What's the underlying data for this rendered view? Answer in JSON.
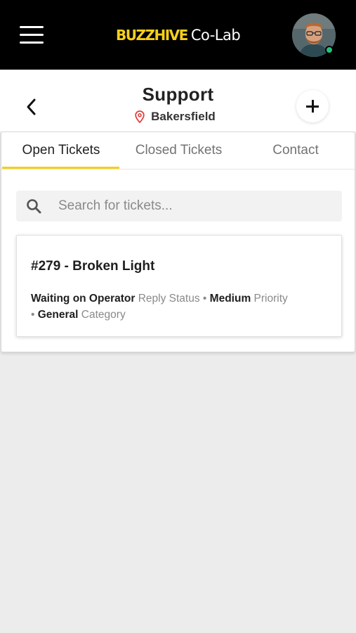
{
  "brand": {
    "buzz": "BUZZHIVE",
    "colab": "Co-Lab",
    "accent_color": "#f5cf1a"
  },
  "user": {
    "online_status_color": "#22c27d"
  },
  "header": {
    "title": "Support",
    "location": "Bakersfield"
  },
  "tabs": [
    {
      "label": "Open Tickets",
      "active": true
    },
    {
      "label": "Closed Tickets",
      "active": false
    },
    {
      "label": "Contact",
      "active": false
    }
  ],
  "search": {
    "placeholder": "Search for tickets...",
    "value": ""
  },
  "tickets": [
    {
      "title": "#279 - Broken Light",
      "reply_status": "Waiting on Operator",
      "reply_status_label": "Reply Status",
      "priority": "Medium",
      "priority_label": "Priority",
      "category": "General",
      "category_label": "Category",
      "separator": "•"
    }
  ],
  "icons": {
    "menu": "hamburger-menu-icon",
    "back": "chevron-left-icon",
    "location": "map-pin-icon",
    "add": "plus-icon",
    "search": "search-icon"
  }
}
